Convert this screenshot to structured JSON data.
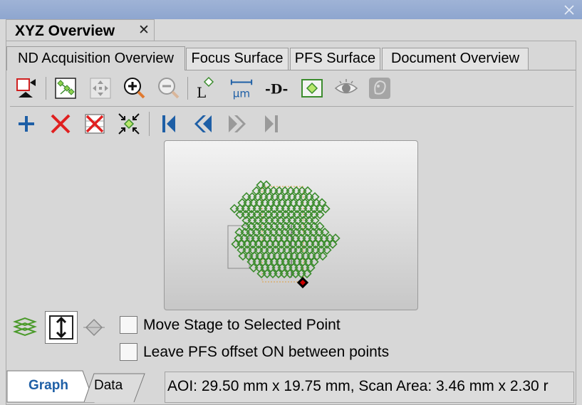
{
  "window": {
    "close_icon": "close-icon"
  },
  "document_tab": {
    "title": "XYZ Overview",
    "close_glyph": "✕"
  },
  "tabs": [
    {
      "label": "ND Acquisition Overview",
      "active": true
    },
    {
      "label": "Focus Surface",
      "active": false
    },
    {
      "label": "PFS Surface",
      "active": false
    },
    {
      "label": "Document Overview",
      "active": false
    }
  ],
  "toolbar1": {
    "items": [
      "select-mode-icon",
      "connect-points-icon",
      "pan-icon",
      "zoom-in-icon",
      "zoom-out-icon",
      "l-shape-icon",
      "micrometer-scale-icon",
      "d-distance-icon",
      "diamond-frame-icon",
      "eye-icon",
      "ghost-icon"
    ],
    "um_label": "μm",
    "l_label": "L",
    "d_label": "-D-"
  },
  "toolbar2": {
    "items": [
      "add-point-icon",
      "delete-point-icon",
      "delete-all-icon",
      "collapse-points-icon",
      "first-point-icon",
      "previous-point-icon",
      "next-point-icon",
      "last-point-icon"
    ]
  },
  "graph": {
    "point_color": "#3c8c2e",
    "selected_point_color": "#000000",
    "selected_point_fill": "#cc0000"
  },
  "options": {
    "move_stage_label": "Move Stage to Selected Point",
    "move_stage_checked": false,
    "leave_pfs_label": "Leave PFS offset ON between points",
    "leave_pfs_checked": false
  },
  "bottom_tabs": [
    {
      "label": "Graph",
      "active": true
    },
    {
      "label": "Data",
      "active": false
    }
  ],
  "status": {
    "text": "AOI: 29.50 mm x 19.75 mm, Scan Area: 3.46 mm x 2.30 r"
  }
}
